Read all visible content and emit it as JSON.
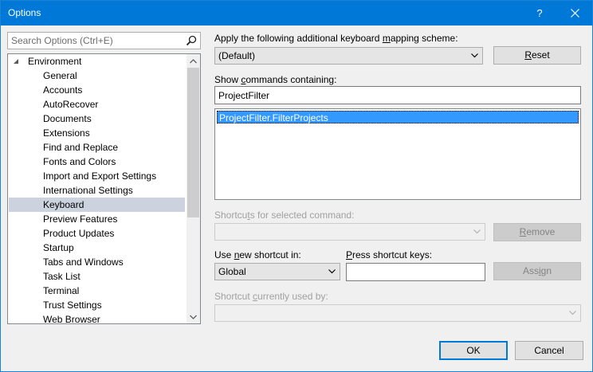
{
  "window": {
    "title": "Options",
    "help_glyph": "?"
  },
  "search": {
    "placeholder": "Search Options (Ctrl+E)"
  },
  "tree": {
    "root": "Environment",
    "items": [
      "General",
      "Accounts",
      "AutoRecover",
      "Documents",
      "Extensions",
      "Find and Replace",
      "Fonts and Colors",
      "Import and Export Settings",
      "International Settings",
      "Keyboard",
      "Preview Features",
      "Product Updates",
      "Startup",
      "Tabs and Windows",
      "Task List",
      "Terminal",
      "Trust Settings",
      "Web Browser"
    ],
    "selected": "Keyboard"
  },
  "mapping": {
    "label_pre": "Apply the following additional keyboard ",
    "label_key": "m",
    "label_post": "apping scheme:",
    "value": "(Default)",
    "reset_key": "R",
    "reset_rest": "eset"
  },
  "commands": {
    "label_pre": "Show ",
    "label_key": "c",
    "label_post": "ommands containing:",
    "value": "ProjectFilter",
    "results": [
      "ProjectFilter.FilterProjects"
    ]
  },
  "shortcuts": {
    "label_pre": "Shortcu",
    "label_key": "t",
    "label_post": "s for selected command:",
    "remove_key": "R",
    "remove_rest": "emove"
  },
  "new_shortcut": {
    "label_pre": "Use ",
    "label_key": "n",
    "label_post": "ew shortcut in:",
    "value": "Global"
  },
  "press_keys": {
    "label_key": "P",
    "label_post": "ress shortcut keys:",
    "value": ""
  },
  "assign": {
    "pre": "Ass",
    "key": "i",
    "post": "gn"
  },
  "used_by": {
    "label_pre": "Shortcut ",
    "label_key": "c",
    "label_post": "urrently used by:"
  },
  "footer": {
    "ok": "OK",
    "cancel": "Cancel"
  },
  "colors": {
    "titlebar": "#0078d7",
    "selection": "#3399ff",
    "tree_selection": "#ccd2de"
  }
}
